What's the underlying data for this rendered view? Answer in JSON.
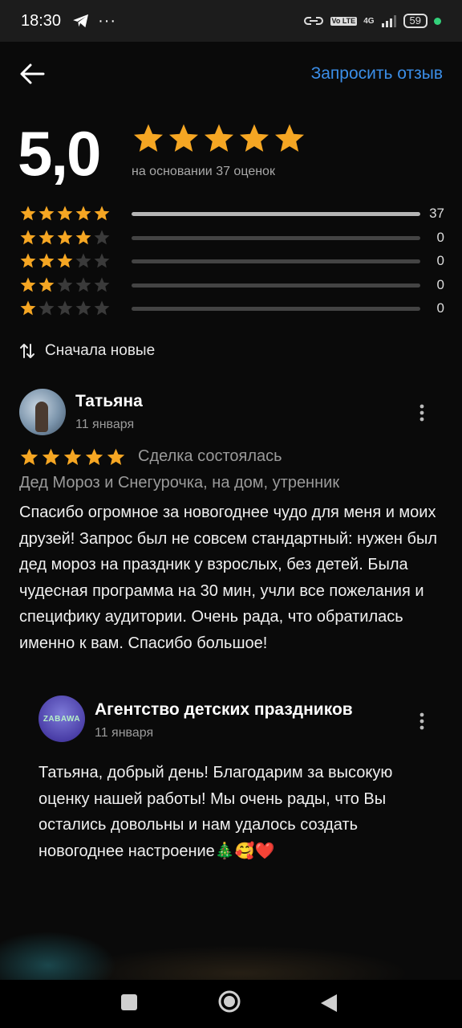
{
  "status_bar": {
    "time": "18:30",
    "dots": "···",
    "network": "4G",
    "volte": "Vo LTE",
    "battery": "59"
  },
  "header": {
    "request_review": "Запросить отзыв"
  },
  "summary": {
    "rating": "5,0",
    "stars": 5,
    "based_on": "на основании 37 оценок"
  },
  "distribution": [
    {
      "stars": 5,
      "count": "37",
      "fraction": 1.0
    },
    {
      "stars": 4,
      "count": "0",
      "fraction": 0
    },
    {
      "stars": 3,
      "count": "0",
      "fraction": 0
    },
    {
      "stars": 2,
      "count": "0",
      "fraction": 0
    },
    {
      "stars": 1,
      "count": "0",
      "fraction": 0
    }
  ],
  "sort": {
    "label": "Сначала новые"
  },
  "review": {
    "author": "Татьяна",
    "date": "11 января",
    "stars": 5,
    "deal_status": "Сделка состоялась",
    "service": "Дед Мороз и Снегурочка, на дом, утренник",
    "text": "Спасибо огромное за новогоднее чудо для меня и моих друзей! Запрос был не совсем стандартный: нужен был дед мороз на праздник у взрослых, без детей. Была чудесная программа на 30 мин, учли все пожелания и специфику аудитории. Очень рада, что обратилась именно к вам. Спасибо большое!"
  },
  "reply": {
    "avatar_logo": "ZABAWA",
    "author": "Агентство детских праздников",
    "date": "11 января",
    "text": "Татьяна, добрый день! Благодарим за высокую оценку нашей работы! Мы очень рады, что Вы остались довольны и нам удалось создать новогоднее настроение🎄🥰❤️"
  },
  "colors": {
    "star": "#f5a623",
    "star_empty": "#3a3a3a",
    "link": "#3b8ee8",
    "battery_dot": "#33d17a"
  },
  "icons": {
    "back": "arrow-left-icon",
    "star": "star-icon",
    "sort": "sort-arrows-icon",
    "menu": "more-vertical-icon",
    "nav_recents": "square-icon",
    "nav_home": "circle-icon",
    "nav_back": "triangle-back-icon"
  }
}
